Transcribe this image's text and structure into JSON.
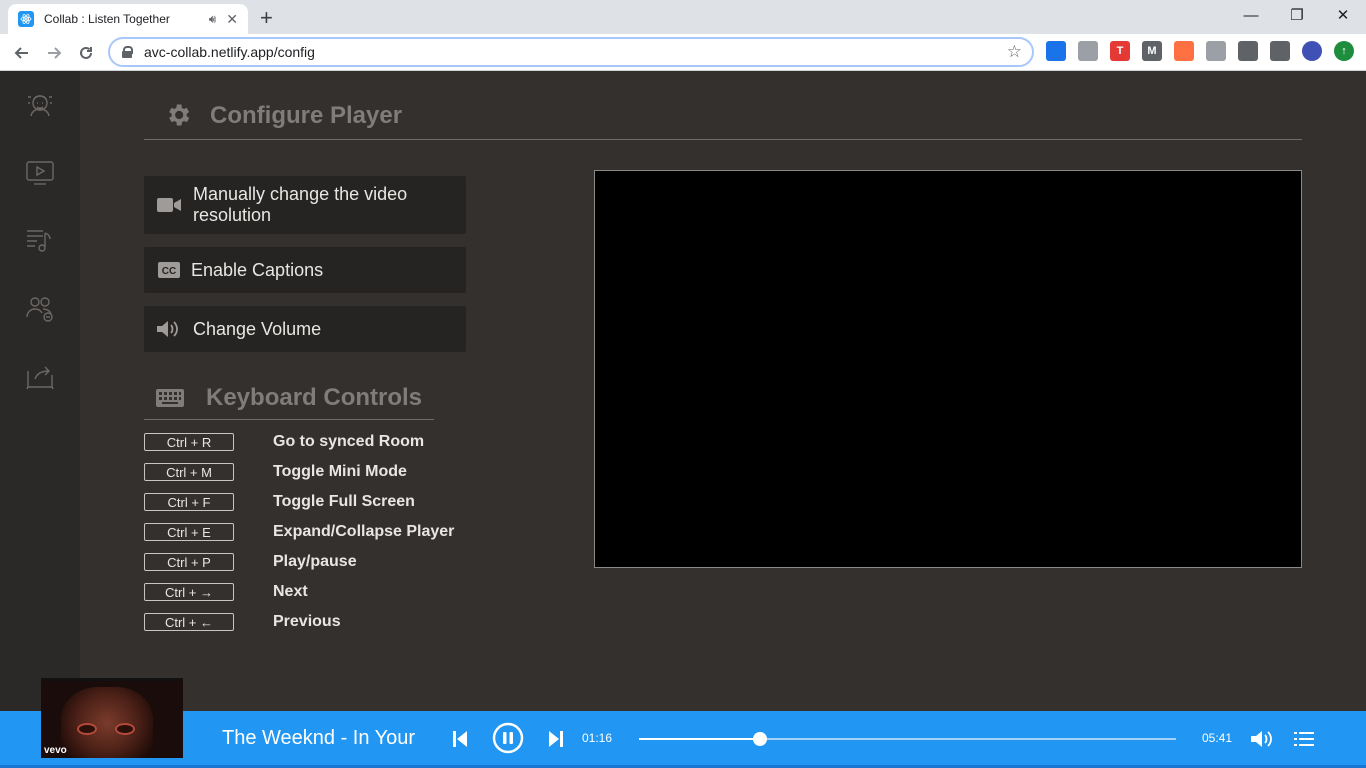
{
  "browser": {
    "tab_title": "Collab : Listen Together",
    "url": "avc-collab.netlify.app/config",
    "new_tab_label": "+",
    "window_minimize": "—",
    "window_restore": "❐",
    "window_close": "✕",
    "extensions": [
      {
        "name": "ext-blue",
        "color": "#1a73e8",
        "glyph": ""
      },
      {
        "name": "ext-photo",
        "color": "#9aa0a6",
        "glyph": ""
      },
      {
        "name": "ext-red",
        "color": "#e53935",
        "glyph": "T"
      },
      {
        "name": "ext-m",
        "color": "#5f6368",
        "glyph": "M"
      },
      {
        "name": "ext-orange",
        "color": "#ff7043",
        "glyph": ""
      },
      {
        "name": "ext-camera",
        "color": "#9aa0a6",
        "glyph": ""
      },
      {
        "name": "ext-puzzle",
        "color": "#5f6368",
        "glyph": ""
      },
      {
        "name": "ext-queue",
        "color": "#5f6368",
        "glyph": ""
      },
      {
        "name": "ext-avatar",
        "color": "#3f51b5",
        "glyph": ""
      },
      {
        "name": "ext-update",
        "color": "#1e8e3e",
        "glyph": "↑"
      }
    ]
  },
  "sidebar": {
    "items": [
      {
        "name": "sidebar-item-profile",
        "icon": "user-face-icon"
      },
      {
        "name": "sidebar-item-player",
        "icon": "tv-play-icon"
      },
      {
        "name": "sidebar-item-playlist",
        "icon": "music-list-icon"
      },
      {
        "name": "sidebar-item-users",
        "icon": "users-icon"
      },
      {
        "name": "sidebar-item-share",
        "icon": "share-screen-icon"
      }
    ]
  },
  "config": {
    "title": "Configure Player",
    "options": [
      {
        "label": "Manually change the video resolution",
        "icon": "video-camera-icon"
      },
      {
        "label": "Enable Captions",
        "icon": "closed-captions-icon"
      },
      {
        "label": "Change Volume",
        "icon": "volume-icon"
      }
    ]
  },
  "keyboard": {
    "title": "Keyboard Controls",
    "rows": [
      {
        "keys": "Ctrl + R",
        "action": "Go to synced Room"
      },
      {
        "keys": "Ctrl + M",
        "action": "Toggle Mini Mode"
      },
      {
        "keys": "Ctrl + F",
        "action": "Toggle Full Screen"
      },
      {
        "keys": "Ctrl + E",
        "action": "Expand/Collapse Player"
      },
      {
        "keys": "Ctrl + P",
        "action": "Play/pause"
      },
      {
        "keys": "Ctrl + →",
        "action": "Next"
      },
      {
        "keys": "Ctrl + ←",
        "action": "Previous"
      }
    ]
  },
  "player": {
    "song_title": "The Weeknd - In Your",
    "current_time": "01:16",
    "total_time": "05:41",
    "progress": 0.225,
    "thumbnail_brand": "vevo",
    "accent": "#2196f3"
  }
}
